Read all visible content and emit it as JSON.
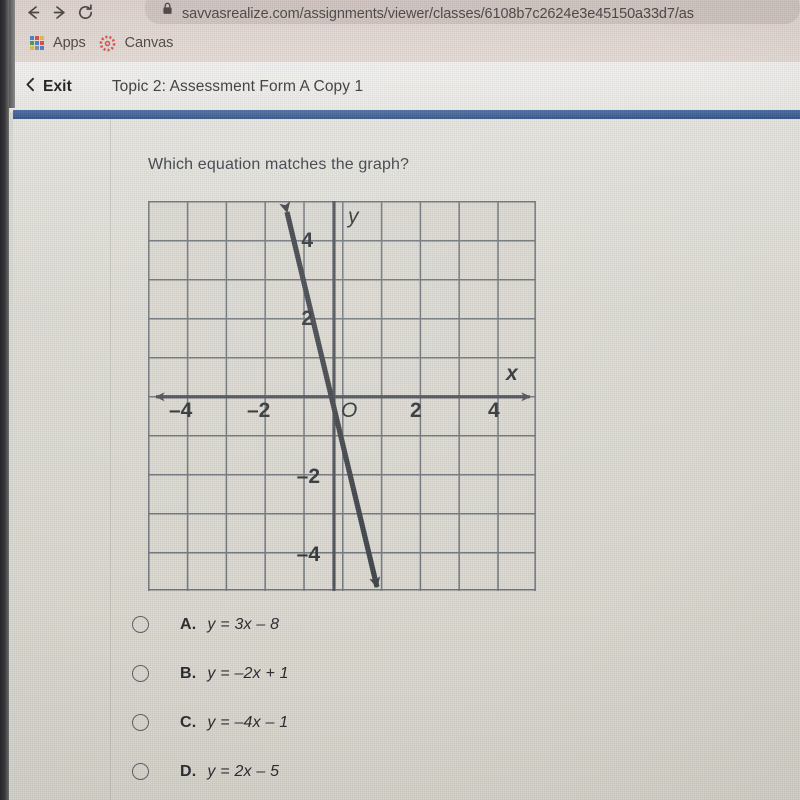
{
  "browser": {
    "nav": {
      "back_icon": "arrow-left-icon",
      "forward_icon": "arrow-right-icon",
      "reload_icon": "reload-icon"
    },
    "address_bar": {
      "lock_icon": "lock-icon",
      "url": "savvasrealize.com/assignments/viewer/classes/6108b7c2624e3e45150a33d7/as"
    },
    "bookmarks": [
      {
        "label": "Apps",
        "icon": "apps-grid-icon"
      },
      {
        "label": "Canvas",
        "icon": "canvas-logo-icon"
      }
    ]
  },
  "assessment_header": {
    "back_icon": "chevron-left-icon",
    "exit_label": "Exit",
    "title": "Topic 2: Assessment Form A Copy 1",
    "accent_color": "#3f6197"
  },
  "question": {
    "prompt": "Which equation matches the graph?",
    "choices": [
      {
        "letter": "A.",
        "equation": "y = 3x – 8",
        "selected": false
      },
      {
        "letter": "B.",
        "equation": "y = –2x + 1",
        "selected": false
      },
      {
        "letter": "C.",
        "equation": "y = –4x – 1",
        "selected": false
      },
      {
        "letter": "D.",
        "equation": "y = 2x – 5",
        "selected": false
      }
    ]
  },
  "chart_data": {
    "type": "line",
    "title": "",
    "xlabel": "x",
    "ylabel": "y",
    "xlim": [
      -5,
      5
    ],
    "ylim": [
      -5,
      5
    ],
    "grid": true,
    "grid_step": 1,
    "x_tick_labels": [
      "–4",
      "–2",
      "O",
      "2",
      "4"
    ],
    "x_tick_values": [
      -4,
      -2,
      0,
      2,
      4
    ],
    "y_tick_labels": [
      "4",
      "2",
      "–2",
      "–4"
    ],
    "y_tick_values": [
      4,
      2,
      -2,
      -4
    ],
    "origin_label": "O",
    "series": [
      {
        "name": "line",
        "equation": "y = -4x - 1",
        "slope": -4,
        "intercept": -1,
        "points": [
          [
            -1.4,
            4.6
          ],
          [
            1.0,
            -5.0
          ]
        ],
        "arrows": "both",
        "color": "#3d4248"
      }
    ],
    "axis_color": "#4c5157",
    "grid_color": "#6e757c",
    "plot_bg": "#dbd9d1"
  }
}
